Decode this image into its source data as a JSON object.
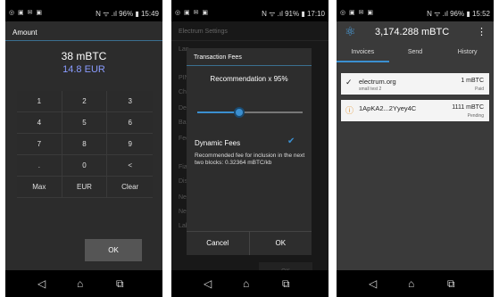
{
  "status": {
    "left_icons": "◎ ▣ ✉ ▣",
    "p1_right": "N ᯤ .ıl 96% ▮ 15:49",
    "p2_right": "N ᯤ .ıl 91% ▮ 17:10",
    "p3_right": "N ᯤ .ıl 96% ▮ 15:52"
  },
  "nav": {
    "back": "◁",
    "home": "⌂",
    "recent": "⧉"
  },
  "screen1": {
    "header": "Amount",
    "btc_value": "38 mBTC",
    "fiat_value": "14.8 EUR",
    "keys": [
      "1",
      "2",
      "3",
      "4",
      "5",
      "6",
      "7",
      "8",
      "9",
      ".",
      "0",
      "<",
      "Max",
      "EUR",
      "Clear"
    ],
    "ok_label": "OK"
  },
  "screen2": {
    "settings_title": "Electrum Settings",
    "bg_items": [
      "Lan",
      "PIN",
      "Cha",
      "Den",
      "Bas",
      "Fee",
      "Fiat",
      "Disp",
      "Net",
      "Netv",
      "Lab"
    ],
    "dialog_title": "Transaction Fees",
    "recommendation": "Recommendation x 95%",
    "slider_fraction": 0.4,
    "dynamic_fees_label": "Dynamic Fees",
    "check_icon": "✔",
    "description": "Recommended fee for inclusion in the next two blocks: 0.32364 mBTC/kb",
    "cancel_label": "Cancel",
    "ok_label": "OK",
    "bg_ok_label": "OK"
  },
  "screen3": {
    "logo_icon": "⚛",
    "balance": "3,174.288 mBTC",
    "menu_icon": "⋮",
    "tabs": [
      "Invoices",
      "Send",
      "History"
    ],
    "invoices": [
      {
        "icon": "✓",
        "title": "electrum.org",
        "desc": "small test 2",
        "amount": "1 mBTC",
        "status": "Paid"
      },
      {
        "icon": "ⓘ",
        "title": "1ApKA2...2Yyey4C",
        "desc": "",
        "amount": "1111 mBTC",
        "status": "Pending"
      }
    ]
  },
  "colors": {
    "accent": "#3b8fd0",
    "fiat": "#8a9cff"
  }
}
